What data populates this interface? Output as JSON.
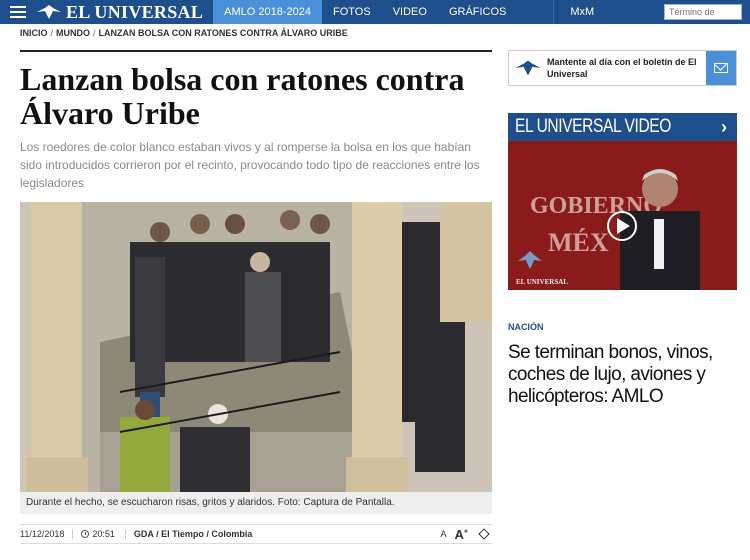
{
  "nav": {
    "logo_text": "EL UNIVERSAL",
    "items": [
      "AMLO 2018-2024",
      "FOTOS",
      "VIDEO",
      "GRÁFICOS",
      "MxM"
    ],
    "search_placeholder": "Término de"
  },
  "breadcrumb": [
    "INICIO",
    "MUNDO",
    "LANZAN BOLSA CON RATONES CONTRA ÁLVARO URIBE"
  ],
  "article": {
    "title": "Lanzan bolsa con ratones contra Álvaro Uribe",
    "summary": "Los roedores de color blanco estaban vivos y al romperse la bolsa en los que habían sido introducidos corrieron por el recinto, provocando todo tipo de reacciones entre los legisladores",
    "caption": "Durante el hecho, se escucharon risas, gritos y alaridos. Foto: Captura de Pantalla.",
    "date": "11/12/2018",
    "time": "20:51",
    "source": "GDA / El Tiempo / Colombia",
    "font_small": "A",
    "font_big": "A"
  },
  "sidebar": {
    "newsletter_text": "Mantente al día con el boletín de El Universal",
    "video_header": "EL UNIVERSAL VIDEO",
    "video_bg_text_1": "GOBIERNO",
    "video_bg_text_2": "MÉX",
    "video_watermark": "EL UNIVERSAL",
    "section_tag": "NACIÓN",
    "headline": "Se terminan bonos, vinos, coches de lujo, aviones y helicópteros: AMLO"
  },
  "colors": {
    "brand_blue": "#1f4e8c",
    "accent_blue": "#4a90d9",
    "video_red": "#8d1c1c"
  }
}
